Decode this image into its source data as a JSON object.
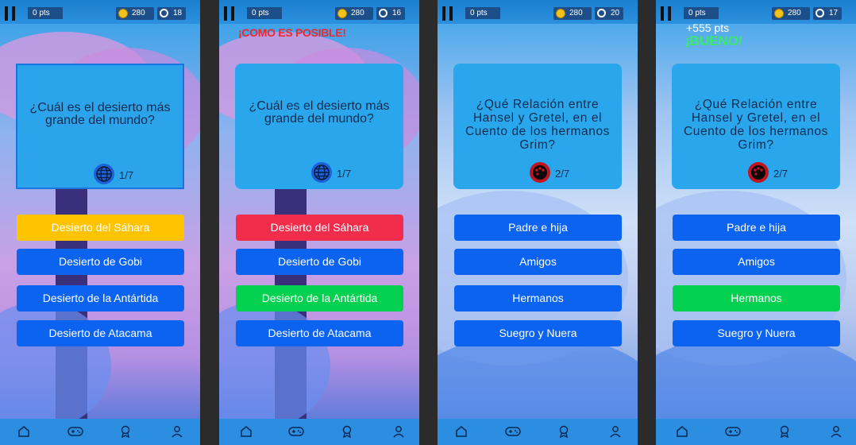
{
  "colors": {
    "answer_default": "#0c63f0",
    "answer_selected": "#ffc300",
    "answer_wrong": "#f22c4b",
    "answer_correct": "#04d14f",
    "card": "#2aa6ec"
  },
  "screens": [
    {
      "pts": "0 pts",
      "coins": "280",
      "timer": "18",
      "overlay_main": "",
      "overlay_sub": "",
      "question": "¿Cuál es el desierto más grande del mundo?",
      "category_icon": "globe-icon",
      "counter": "1/7",
      "answers": [
        "Desierto del Sáhara",
        "Desierto de Gobi",
        "Desierto de la Antártida",
        "Desierto de Atacama"
      ]
    },
    {
      "pts": "0 pts",
      "coins": "280",
      "timer": "16",
      "overlay_main": "¡COMO ES POSIBLE!",
      "overlay_sub": "",
      "question": "¿Cuál es el desierto más grande del mundo?",
      "category_icon": "globe-icon",
      "counter": "1/7",
      "answers": [
        "Desierto del Sáhara",
        "Desierto de Gobi",
        "Desierto de la Antártida",
        "Desierto de Atacama"
      ]
    },
    {
      "pts": "0 pts",
      "coins": "280",
      "timer": "20",
      "overlay_main": "",
      "overlay_sub": "",
      "question": "¿Qué Relación entre Hansel y Gretel, en el Cuento de los hermanos Grim?",
      "category_icon": "music-palette-icon",
      "counter": "2/7",
      "answers": [
        "Padre e hija",
        "Amigos",
        "Hermanos",
        "Suegro y Nuera"
      ]
    },
    {
      "pts": "0 pts",
      "coins": "280",
      "timer": "17",
      "overlay_main": "¡BUENO!",
      "overlay_sub": "+555 pts",
      "question": "¿Qué Relación entre Hansel y Gretel, en el Cuento de los hermanos Grim?",
      "category_icon": "music-palette-icon",
      "counter": "2/7",
      "answers": [
        "Padre e hija",
        "Amigos",
        "Hermanos",
        "Suegro y Nuera"
      ]
    }
  ],
  "nav": [
    "home-icon",
    "gamepad-icon",
    "award-icon",
    "profile-icon"
  ]
}
